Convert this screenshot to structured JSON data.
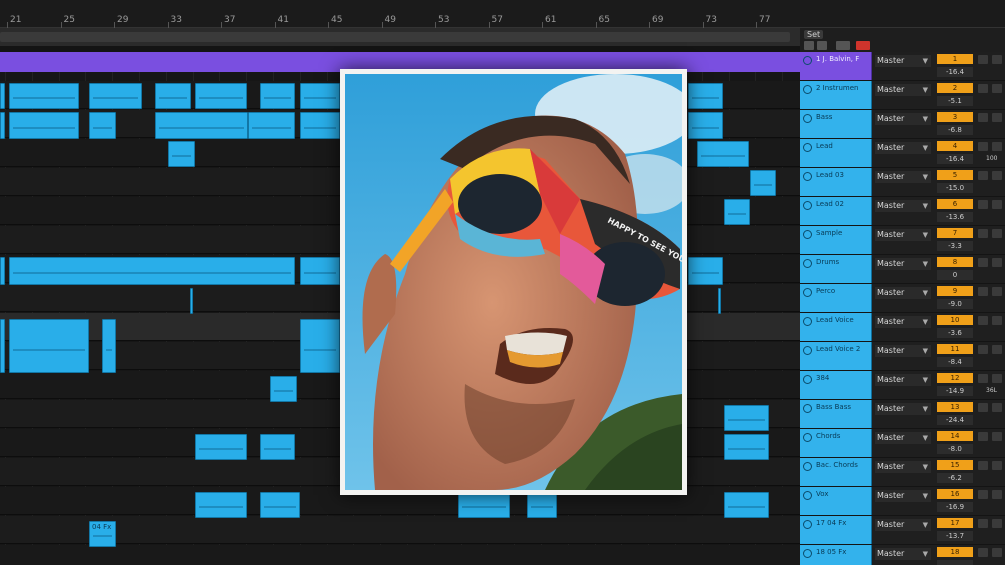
{
  "ruler": {
    "bars": [
      "21",
      "25",
      "29",
      "33",
      "37",
      "41",
      "45",
      "49",
      "53",
      "57",
      "61",
      "65",
      "69",
      "73",
      "77"
    ]
  },
  "set_panel": {
    "label": "Set"
  },
  "tracks": [
    {
      "name": "1 J. Balvin, F",
      "routing": "Master",
      "volume": "1",
      "pan": "-16.4"
    },
    {
      "name": "2 Instrumen",
      "routing": "Master",
      "volume": "2",
      "pan": "-5.1"
    },
    {
      "name": "Bass",
      "routing": "Master",
      "volume": "3",
      "pan": "-6.8"
    },
    {
      "name": "Lead",
      "routing": "Master",
      "volume": "4",
      "pan": "-16.4",
      "side": "100"
    },
    {
      "name": "Lead 03",
      "routing": "Master",
      "volume": "5",
      "pan": "-15.0"
    },
    {
      "name": "Lead 02",
      "routing": "Master",
      "volume": "6",
      "pan": "-13.6"
    },
    {
      "name": "Sample",
      "routing": "Master",
      "volume": "7",
      "pan": "-3.3"
    },
    {
      "name": "Drums",
      "routing": "Master",
      "volume": "8",
      "pan": "0"
    },
    {
      "name": "Perco",
      "routing": "Master",
      "volume": "9",
      "pan": "-9.0"
    },
    {
      "name": "Lead Voice",
      "routing": "Master",
      "volume": "10",
      "pan": "-3.6"
    },
    {
      "name": "Lead Voice 2",
      "routing": "Master",
      "volume": "11",
      "pan": "-8.4"
    },
    {
      "name": "384",
      "routing": "Master",
      "volume": "12",
      "pan": "-14.9",
      "side": "36L"
    },
    {
      "name": "Bass Bass",
      "routing": "Master",
      "volume": "13",
      "pan": "-24.4"
    },
    {
      "name": "Chords",
      "routing": "Master",
      "volume": "14",
      "pan": "-8.0"
    },
    {
      "name": "Bac. Chords",
      "routing": "Master",
      "volume": "15",
      "pan": "-6.2"
    },
    {
      "name": "Vox",
      "routing": "Master",
      "volume": "16",
      "pan": "-16.9"
    },
    {
      "name": "17 04 Fx",
      "routing": "Master",
      "volume": "17",
      "pan": "-13.7"
    },
    {
      "name": "18 05 Fx",
      "routing": "Master",
      "volume": "18",
      "pan": ""
    }
  ],
  "clip_labels": {
    "fx_clip": "04 Fx"
  },
  "photo": {
    "glasses_text": "HAPPY TO SEE YOU"
  },
  "colors": {
    "clip_blue": "#29aee9",
    "track_purple": "#7a4fe0",
    "volume_orange": "#f0a019",
    "background": "#141414"
  },
  "icons": {
    "routing_dropdown": "chevron-down-icon",
    "track_activator": "circle-icon"
  }
}
